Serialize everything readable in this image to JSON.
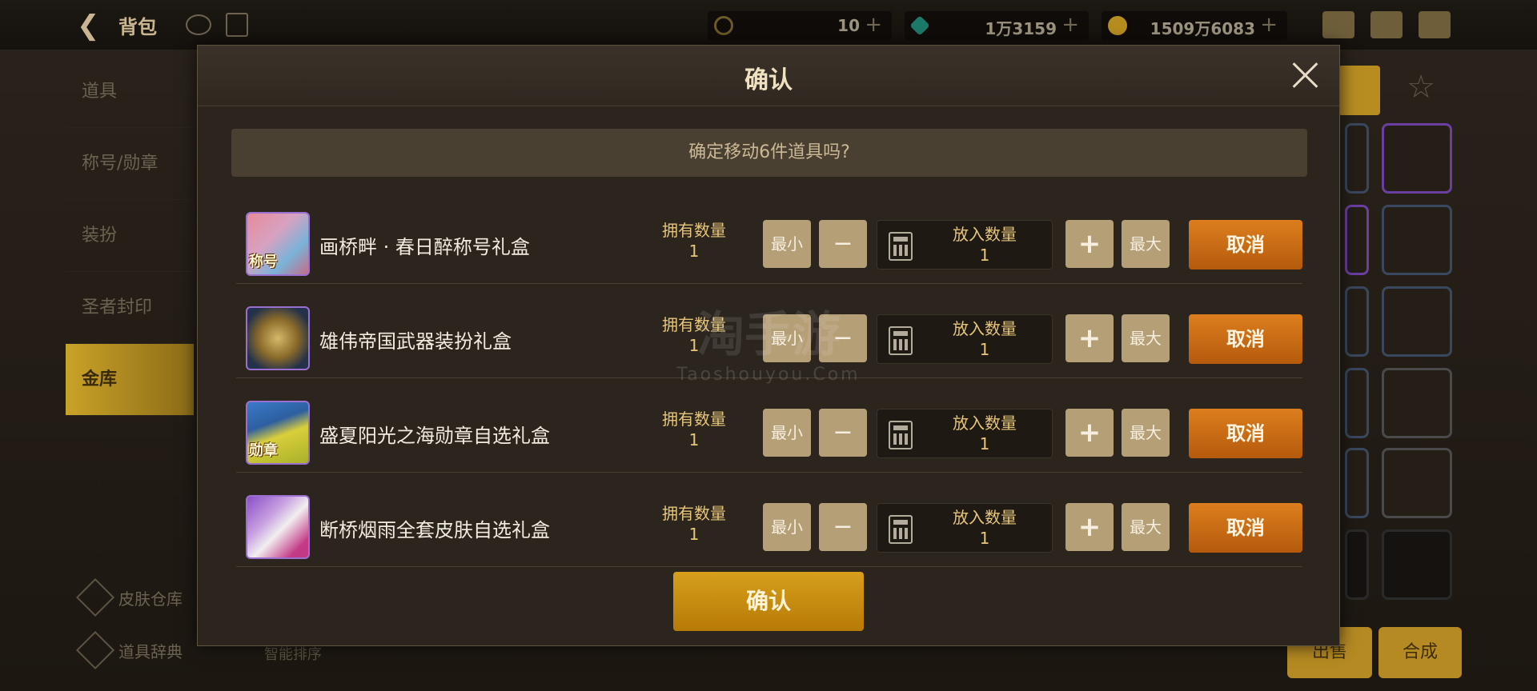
{
  "topbar": {
    "title": "背包",
    "currency": [
      {
        "icon": "moon-token-icon",
        "value": "10"
      },
      {
        "icon": "crystal-icon",
        "value": "1万3159"
      },
      {
        "icon": "gold-coin-icon",
        "value": "1509万6083"
      }
    ]
  },
  "left_menu": {
    "items": [
      {
        "label": "道具"
      },
      {
        "label": "称号/勋章"
      },
      {
        "label": "装扮"
      },
      {
        "label": "圣者封印"
      },
      {
        "label": "金库"
      }
    ],
    "bottom_links": [
      {
        "label": "皮肤仓库"
      },
      {
        "label": "道具辞典"
      }
    ],
    "sort_label": "智能排序"
  },
  "right_panel": {
    "sell_label": "出售",
    "combine_label": "合成"
  },
  "modal": {
    "title": "确认",
    "question": "确定移动6件道具吗?",
    "confirm_label": "确认",
    "rows": [
      {
        "name": "画桥畔 · 春日醉称号礼盒",
        "icon_tag": "称号",
        "owned_label": "拥有数量",
        "owned": "1",
        "qty_label": "放入数量",
        "qty": "1",
        "min_label": "最小",
        "max_label": "最大",
        "cancel_label": "取消",
        "minus": "−",
        "plus": "+"
      },
      {
        "name": "雄伟帝国武器装扮礼盒",
        "icon_tag": "",
        "owned_label": "拥有数量",
        "owned": "1",
        "qty_label": "放入数量",
        "qty": "1",
        "min_label": "最小",
        "max_label": "最大",
        "cancel_label": "取消",
        "minus": "−",
        "plus": "+"
      },
      {
        "name": "盛夏阳光之海勋章自选礼盒",
        "icon_tag": "勋章",
        "owned_label": "拥有数量",
        "owned": "1",
        "qty_label": "放入数量",
        "qty": "1",
        "min_label": "最小",
        "max_label": "最大",
        "cancel_label": "取消",
        "minus": "−",
        "plus": "+"
      },
      {
        "name": "断桥烟雨全套皮肤自选礼盒",
        "icon_tag": "",
        "owned_label": "拥有数量",
        "owned": "1",
        "qty_label": "放入数量",
        "qty": "1",
        "min_label": "最小",
        "max_label": "最大",
        "cancel_label": "取消",
        "minus": "−",
        "plus": "+"
      }
    ]
  },
  "watermark": {
    "logo": "淘手游",
    "site": "Taoshouyou.Com"
  },
  "colors": {
    "cancel": "#c86a12",
    "confirm": "#c98d12",
    "item_border": "#9a6fd0"
  }
}
